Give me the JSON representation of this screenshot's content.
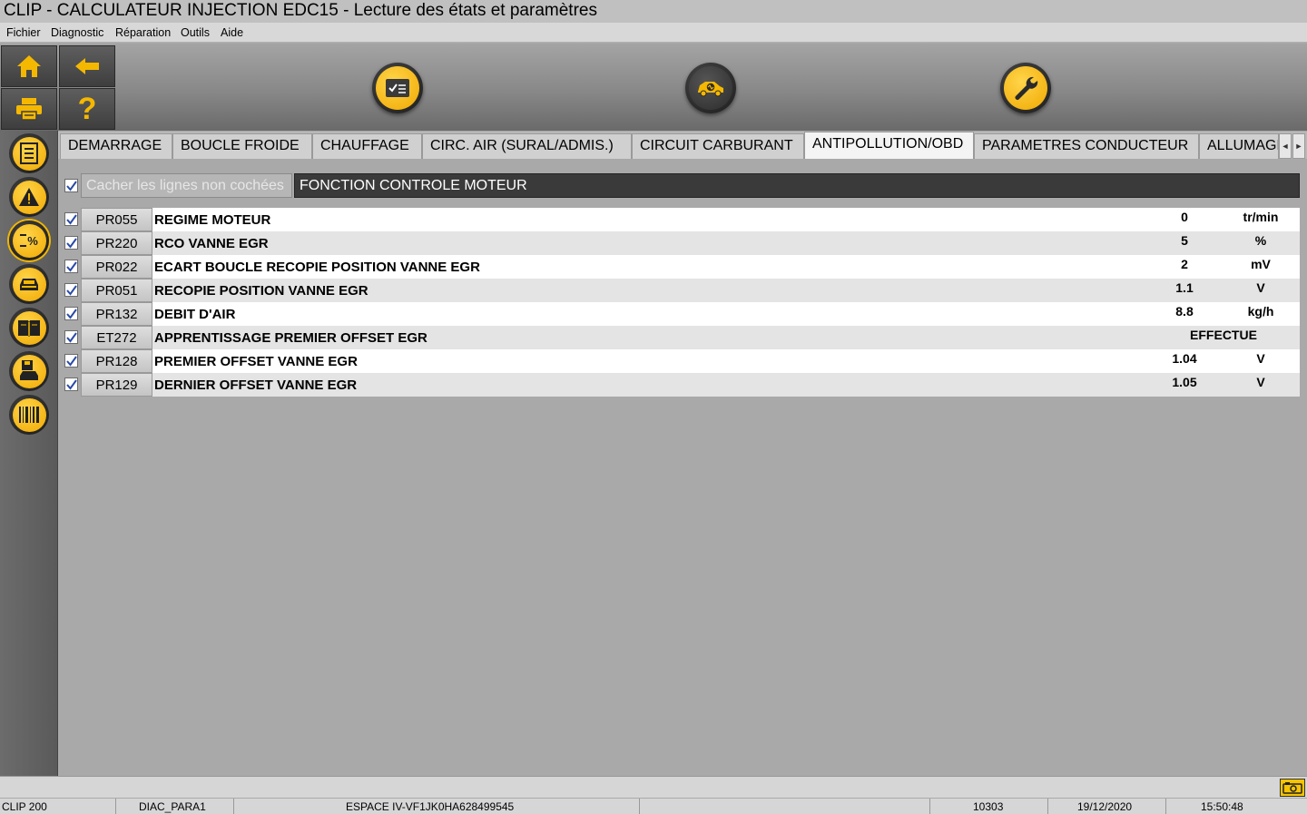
{
  "window": {
    "title": "CLIP - CALCULATEUR INJECTION EDC15 - Lecture des états et paramètres"
  },
  "menu": [
    "Fichier",
    "Diagnostic",
    "Réparation",
    "Outils",
    "Aide"
  ],
  "toolbar": {
    "left_icons": [
      "home-icon",
      "back-arrow-icon",
      "printer-icon",
      "help-icon"
    ],
    "help_glyph": "?",
    "center_icons": [
      "checklist-icon",
      "vehicle-diagnostic-icon",
      "wrench-icon"
    ]
  },
  "sidebar": {
    "icons": [
      "document-list-icon",
      "warning-icon",
      "parameters-percent-icon",
      "vehicle-icon",
      "book-icon",
      "save-vehicle-icon",
      "barcode-icon"
    ],
    "percent_glyph": "%"
  },
  "tabs": [
    "DEMARRAGE",
    "BOUCLE FROIDE",
    "CHAUFFAGE",
    "CIRC. AIR (SURAL/ADMIS.)",
    "CIRCUIT CARBURANT",
    "ANTIPOLLUTION/OBD",
    "PARAMETRES CONDUCTEUR",
    "ALLUMAGE"
  ],
  "active_tab": "ANTIPOLLUTION/OBD",
  "filter": {
    "label": "Cacher les lignes non cochées",
    "checked": true
  },
  "function_header": "FONCTION CONTROLE MOTEUR",
  "rows": [
    {
      "code": "PR055",
      "label": "REGIME MOTEUR",
      "value": "0",
      "unit": "tr/min",
      "checked": true
    },
    {
      "code": "PR220",
      "label": "RCO VANNE EGR",
      "value": "5",
      "unit": "%",
      "checked": true
    },
    {
      "code": "PR022",
      "label": "ECART BOUCLE RECOPIE POSITION VANNE EGR",
      "value": "2",
      "unit": "mV",
      "checked": true
    },
    {
      "code": "PR051",
      "label": "RECOPIE POSITION VANNE EGR",
      "value": "1.1",
      "unit": "V",
      "checked": true
    },
    {
      "code": "PR132",
      "label": "DEBIT D'AIR",
      "value": "8.8",
      "unit": "kg/h",
      "checked": true
    },
    {
      "code": "ET272",
      "label": "APPRENTISSAGE PREMIER OFFSET EGR",
      "value": "EFFECTUE",
      "unit": "",
      "checked": true
    },
    {
      "code": "PR128",
      "label": "PREMIER OFFSET VANNE EGR",
      "value": "1.04",
      "unit": "V",
      "checked": true
    },
    {
      "code": "PR129",
      "label": "DERNIER OFFSET VANNE EGR",
      "value": "1.05",
      "unit": "V",
      "checked": true
    }
  ],
  "status": {
    "device": "CLIP 200",
    "session": "DIAC_PARA1",
    "vehicle": "ESPACE IV-VF1JK0HA628499545",
    "code": "10303",
    "date": "19/12/2020",
    "time": "15:50:48"
  },
  "colors": {
    "accent": "#f5b800",
    "header_dark": "#3a3a3a",
    "row_even": "#ffffff",
    "row_odd": "#e4e4e4"
  }
}
